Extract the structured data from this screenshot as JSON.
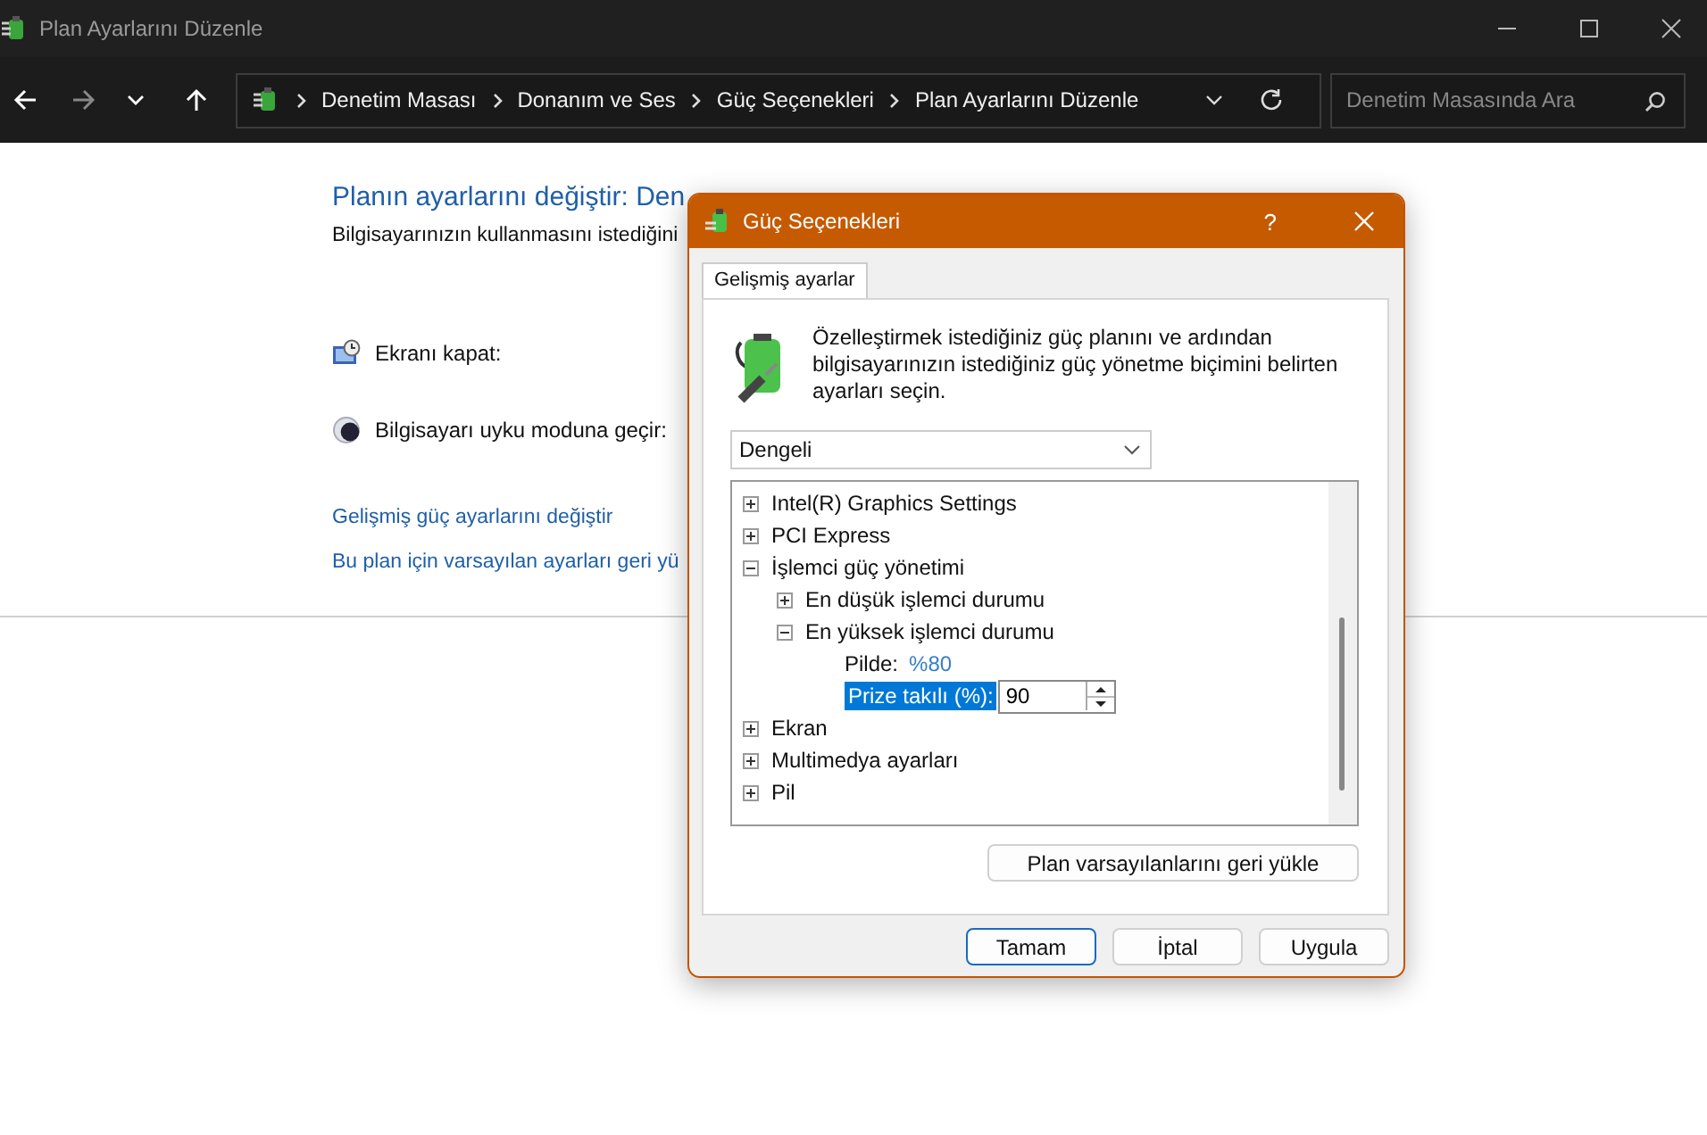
{
  "window": {
    "title": "Plan Ayarlarını Düzenle"
  },
  "navigation": {
    "forward_disabled": true,
    "breadcrumbs": [
      "Denetim Masası",
      "Donanım ve Ses",
      "Güç Seçenekleri",
      "Plan Ayarlarını Düzenle"
    ],
    "search": {
      "placeholder": "Denetim Masasında Ara"
    }
  },
  "page": {
    "heading": "Planın ayarlarını değiştir: Den",
    "description": "Bilgisayarınızın kullanmasını istediğini",
    "settings": [
      {
        "kind": "display",
        "label": "Ekranı kapat:"
      },
      {
        "kind": "sleep",
        "label": "Bilgisayarı uyku moduna geçir:"
      }
    ],
    "links": [
      "Gelişmiş güç ayarlarını değiştir",
      "Bu plan için varsayılan ayarları geri yü"
    ]
  },
  "dialog": {
    "title": "Güç Seçenekleri",
    "help": "?",
    "tabs": [
      {
        "label": "Gelişmiş ayarlar",
        "selected": true
      }
    ],
    "intro": "Özelleştirmek istediğiniz güç planını ve ardından bilgisayarınızın istediğiniz güç yönetme biçimini belirten ayarları seçin.",
    "plan": "Dengeli",
    "tree": [
      {
        "kind": "node",
        "label": "Intel(R) Graphics Settings",
        "expanded": false
      },
      {
        "kind": "node",
        "label": "PCI Express",
        "expanded": false
      },
      {
        "kind": "node",
        "label": "İşlemci güç yönetimi",
        "expanded": true,
        "children": [
          {
            "kind": "node",
            "label": "En düşük işlemci durumu",
            "expanded": false
          },
          {
            "kind": "node",
            "label": "En yüksek işlemci durumu",
            "expanded": true,
            "children": [
              {
                "kind": "value",
                "label": "Pilde:",
                "value": "%80"
              },
              {
                "kind": "edit",
                "label": "Prize takılı (%):",
                "value": "90",
                "selected": true
              }
            ]
          }
        ]
      },
      {
        "kind": "node",
        "label": "Ekran",
        "expanded": false
      },
      {
        "kind": "node",
        "label": "Multimedya ayarları",
        "expanded": false
      },
      {
        "kind": "node",
        "label": "Pil",
        "expanded": false
      }
    ],
    "restore_button": "Plan varsayılanlarını geri yükle",
    "buttons": [
      {
        "label": "Tamam",
        "default": true
      },
      {
        "label": "İptal",
        "default": false
      },
      {
        "label": "Uygula",
        "default": false
      }
    ]
  }
}
